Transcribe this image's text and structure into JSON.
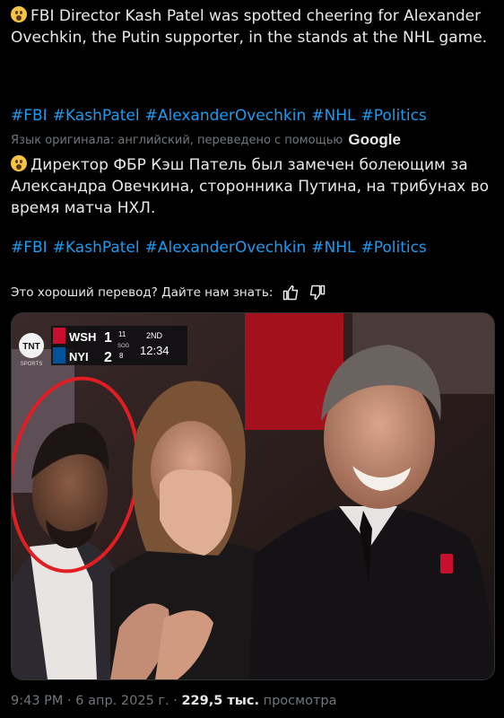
{
  "post": {
    "text_en": "FBI Director Kash Patel was spotted cheering for Alexander Ovechkin, the Putin supporter, in the stands at the NHL game.",
    "hashtags": [
      "#FBI",
      "#KashPatel",
      "#AlexanderOvechkin",
      "#NHL",
      "#Politics"
    ],
    "translation_note": "Язык оригинала: английский, переведено с помощью",
    "translation_provider": "Google",
    "text_ru": "Директор ФБР Кэш Патель был замечен болеющим за Александра Овечкина, сторонника Путина, на трибунах во время матча НХЛ.",
    "feedback_prompt": "Это хороший перевод? Дайте нам знать:"
  },
  "scoreboard": {
    "network": "TNT",
    "network_sub": "SPORTS",
    "team1": "WSH",
    "score1": "1",
    "shots1": "11",
    "team2": "NYI",
    "score2": "2",
    "shots2": "8",
    "sog_label": "SOG",
    "period": "2ND",
    "clock": "12:34"
  },
  "footer": {
    "time": "9:43 PM",
    "date": "6 апр. 2025 г.",
    "views": "229,5 тыс.",
    "views_label": "просмотра"
  },
  "colors": {
    "link": "#1d9bf0",
    "muted": "#71767b",
    "text": "#e7e9ea",
    "circle": "#e01e24"
  }
}
